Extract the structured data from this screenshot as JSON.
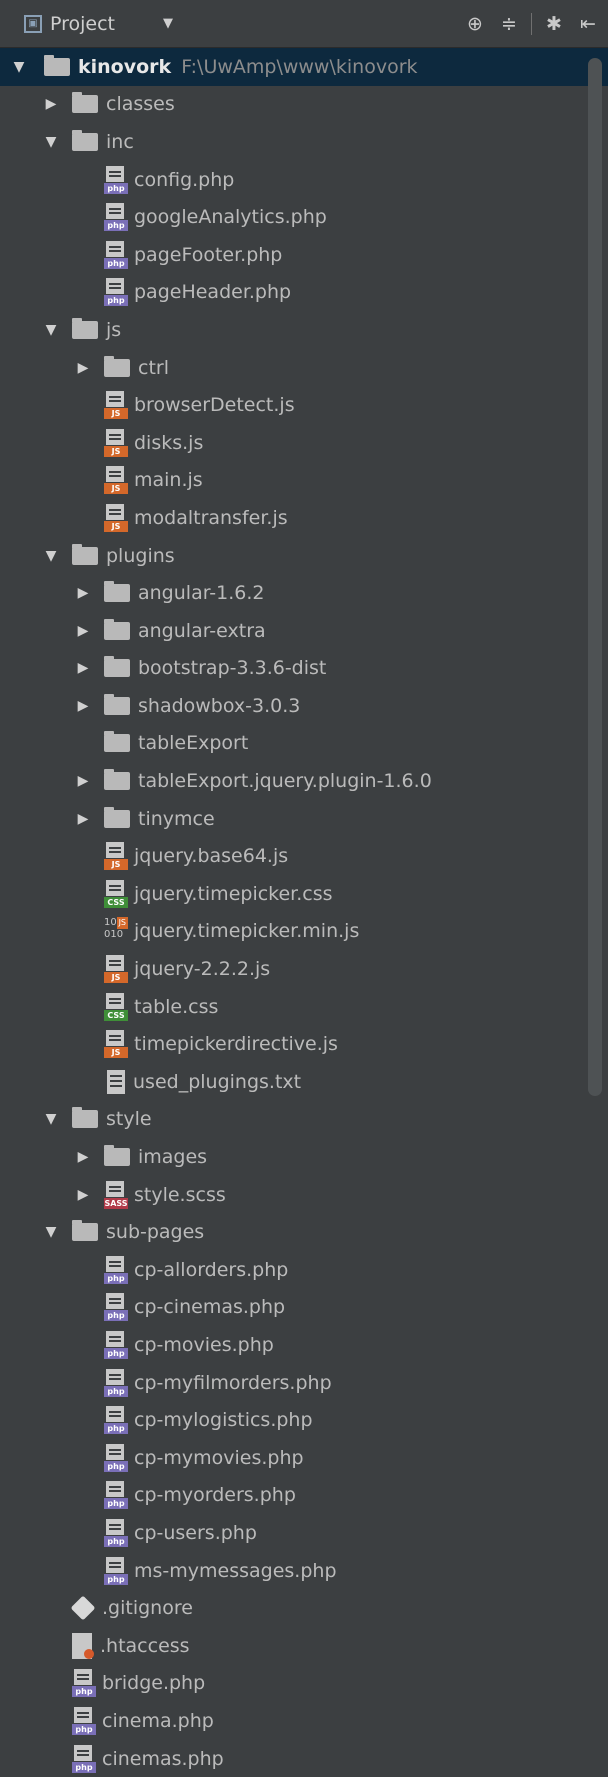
{
  "toolbar": {
    "title": "Project",
    "icons": [
      "crosshair-icon",
      "collapse-icon",
      "gear-icon",
      "hide-icon"
    ]
  },
  "root": {
    "name": "kinovork",
    "path": "F:\\UwAmp\\www\\kinovork"
  },
  "tree": [
    {
      "depth": 1,
      "kind": "folder",
      "expanded": false,
      "label": "classes"
    },
    {
      "depth": 1,
      "kind": "folder",
      "expanded": true,
      "label": "inc"
    },
    {
      "depth": 2,
      "kind": "php",
      "label": "config.php"
    },
    {
      "depth": 2,
      "kind": "php",
      "label": "googleAnalytics.php"
    },
    {
      "depth": 2,
      "kind": "php",
      "label": "pageFooter.php"
    },
    {
      "depth": 2,
      "kind": "php",
      "label": "pageHeader.php"
    },
    {
      "depth": 1,
      "kind": "folder",
      "expanded": true,
      "label": "js"
    },
    {
      "depth": 2,
      "kind": "folder",
      "expanded": false,
      "label": "ctrl"
    },
    {
      "depth": 2,
      "kind": "js",
      "label": "browserDetect.js"
    },
    {
      "depth": 2,
      "kind": "js",
      "label": "disks.js"
    },
    {
      "depth": 2,
      "kind": "js",
      "label": "main.js"
    },
    {
      "depth": 2,
      "kind": "js",
      "label": "modaltransfer.js"
    },
    {
      "depth": 1,
      "kind": "folder",
      "expanded": true,
      "label": "plugins"
    },
    {
      "depth": 2,
      "kind": "folder",
      "expanded": false,
      "label": "angular-1.6.2"
    },
    {
      "depth": 2,
      "kind": "folder",
      "expanded": false,
      "label": "angular-extra"
    },
    {
      "depth": 2,
      "kind": "folder",
      "expanded": false,
      "label": "bootstrap-3.3.6-dist"
    },
    {
      "depth": 2,
      "kind": "folder",
      "expanded": false,
      "label": "shadowbox-3.0.3"
    },
    {
      "depth": 2,
      "kind": "folder",
      "expanded": null,
      "label": "tableExport"
    },
    {
      "depth": 2,
      "kind": "folder",
      "expanded": false,
      "label": "tableExport.jquery.plugin-1.6.0"
    },
    {
      "depth": 2,
      "kind": "folder",
      "expanded": false,
      "label": "tinymce"
    },
    {
      "depth": 2,
      "kind": "js",
      "label": "jquery.base64.js"
    },
    {
      "depth": 2,
      "kind": "css",
      "label": "jquery.timepicker.css"
    },
    {
      "depth": 2,
      "kind": "minjs",
      "label": "jquery.timepicker.min.js"
    },
    {
      "depth": 2,
      "kind": "js",
      "label": "jquery-2.2.2.js"
    },
    {
      "depth": 2,
      "kind": "css",
      "label": "table.css"
    },
    {
      "depth": 2,
      "kind": "js",
      "label": "timepickerdirective.js"
    },
    {
      "depth": 2,
      "kind": "txt",
      "label": "used_plugings.txt"
    },
    {
      "depth": 1,
      "kind": "folder",
      "expanded": true,
      "label": "style"
    },
    {
      "depth": 2,
      "kind": "folder",
      "expanded": false,
      "label": "images"
    },
    {
      "depth": 2,
      "kind": "sass",
      "expanded": false,
      "label": "style.scss"
    },
    {
      "depth": 1,
      "kind": "folder",
      "expanded": true,
      "label": "sub-pages"
    },
    {
      "depth": 2,
      "kind": "php",
      "label": "cp-allorders.php"
    },
    {
      "depth": 2,
      "kind": "php",
      "label": "cp-cinemas.php"
    },
    {
      "depth": 2,
      "kind": "php",
      "label": "cp-movies.php"
    },
    {
      "depth": 2,
      "kind": "php",
      "label": "cp-myfilmorders.php"
    },
    {
      "depth": 2,
      "kind": "php",
      "label": "cp-mylogistics.php"
    },
    {
      "depth": 2,
      "kind": "php",
      "label": "cp-mymovies.php"
    },
    {
      "depth": 2,
      "kind": "php",
      "label": "cp-myorders.php"
    },
    {
      "depth": 2,
      "kind": "php",
      "label": "cp-users.php"
    },
    {
      "depth": 2,
      "kind": "php",
      "label": "ms-mymessages.php"
    },
    {
      "depth": 1,
      "kind": "git",
      "label": ".gitignore"
    },
    {
      "depth": 1,
      "kind": "htaccess",
      "label": ".htaccess"
    },
    {
      "depth": 1,
      "kind": "php",
      "label": "bridge.php"
    },
    {
      "depth": 1,
      "kind": "php",
      "label": "cinema.php"
    },
    {
      "depth": 1,
      "kind": "php",
      "label": "cinemas.php"
    }
  ],
  "tags": {
    "php": "php",
    "js": "JS",
    "css": "CSS",
    "sass": "SASS",
    "minjs_badge": "JS",
    "minjs_digits": "10\n010"
  },
  "colors": {
    "background": "#3c3f41",
    "selection": "#0d293e",
    "php": "#7a6fb7",
    "js": "#d4682a",
    "css": "#3f8e38",
    "sass": "#b03a48"
  }
}
